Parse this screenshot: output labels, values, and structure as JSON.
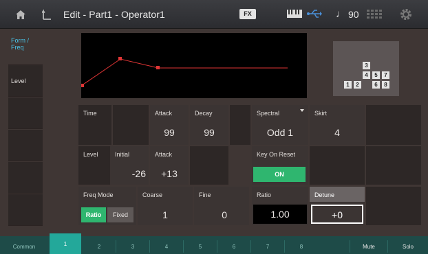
{
  "header": {
    "title": "Edit - Part1 - Operator1",
    "fx_label": "FX",
    "tempo": "90"
  },
  "left_tabs": [
    {
      "label": "Form / Freq"
    },
    {
      "label": "Level"
    }
  ],
  "rows": {
    "time": {
      "label": "Time",
      "attack_label": "Attack",
      "attack": "99",
      "decay_label": "Decay",
      "decay": "99"
    },
    "spectral": {
      "label": "Spectral",
      "value": "Odd 1"
    },
    "skirt": {
      "label": "Skirt",
      "value": "4"
    },
    "level": {
      "label": "Level",
      "initial_label": "Initial",
      "initial": "-26",
      "attack_label": "Attack",
      "attack": "+13"
    },
    "key_on_reset": {
      "label": "Key On Reset",
      "value": "ON"
    },
    "freq_mode": {
      "label": "Freq Mode",
      "ratio": "Ratio",
      "fixed": "Fixed"
    },
    "coarse": {
      "label": "Coarse",
      "value": "1"
    },
    "fine": {
      "label": "Fine",
      "value": "0"
    },
    "ratio": {
      "label": "Ratio",
      "value": "1.00"
    },
    "detune": {
      "label": "Detune",
      "value": "+0"
    }
  },
  "algorithm": [
    "1",
    "2",
    "3",
    "4",
    "5",
    "6",
    "7",
    "8"
  ],
  "bottom": {
    "common": "Common",
    "ops": [
      "1",
      "2",
      "3",
      "4",
      "5",
      "6",
      "7",
      "8"
    ],
    "mute": "Mute",
    "solo": "Solo"
  },
  "colors": {
    "accent": "#49c6ea",
    "on": "#2fb66f",
    "tab_active": "#23a89a",
    "envelope": "#e03535"
  }
}
